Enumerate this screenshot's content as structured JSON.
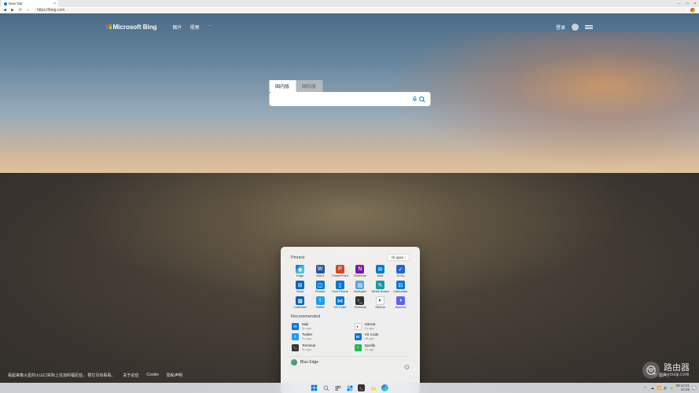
{
  "browser": {
    "tab_title": "New Tab",
    "url": "https://bing.com",
    "window_buttons": {
      "min": "–",
      "max": "□",
      "close": "×"
    }
  },
  "bing": {
    "logo_text": "Microsoft Bing",
    "nav": [
      "图片",
      "视频",
      "···"
    ],
    "login_text": "登录",
    "search_tabs": {
      "domestic": "国内版",
      "intl": "国际版"
    },
    "search_placeholder": "",
    "info_left": "看起来像火星的火山口实际上在加利福尼亚。 把它引向看看。",
    "info_links": [
      "关于必应",
      "Cookie",
      "隐私声明"
    ],
    "camera_badge": "图片",
    "prev": "‹",
    "next": "›"
  },
  "start": {
    "pinned_label": "Pinned",
    "all_apps_label": "All apps ›",
    "apps": [
      {
        "name": "Edge",
        "icon": "◉",
        "cls": "c-edge"
      },
      {
        "name": "Word",
        "icon": "W",
        "cls": "c-word"
      },
      {
        "name": "PowerPoint",
        "icon": "P",
        "cls": "c-ppt"
      },
      {
        "name": "OneNote",
        "icon": "N",
        "cls": "c-onenote"
      },
      {
        "name": "Mail",
        "icon": "✉",
        "cls": "c-mail"
      },
      {
        "name": "To Do",
        "icon": "✓",
        "cls": "c-todo"
      },
      {
        "name": "Store",
        "icon": "⊞",
        "cls": "c-store"
      },
      {
        "name": "Photos",
        "icon": "◫",
        "cls": "c-photos"
      },
      {
        "name": "Your Phone",
        "icon": "▯",
        "cls": "c-phone"
      },
      {
        "name": "Notepad",
        "icon": "▤",
        "cls": "c-notepad"
      },
      {
        "name": "White Board",
        "icon": "✎",
        "cls": "c-wb"
      },
      {
        "name": "Calculator",
        "icon": "⊟",
        "cls": "c-calc"
      },
      {
        "name": "Calendar",
        "icon": "▦",
        "cls": "c-cal"
      },
      {
        "name": "Twitter",
        "icon": "t",
        "cls": "c-twitter"
      },
      {
        "name": "VS Code",
        "icon": "⋈",
        "cls": "c-vscode"
      },
      {
        "name": "Terminal",
        "icon": "›_",
        "cls": "c-term"
      },
      {
        "name": "GitHub",
        "icon": "◐",
        "cls": "c-github"
      },
      {
        "name": "Discord",
        "icon": "◑",
        "cls": "c-discord"
      }
    ],
    "recommended_label": "Recommended",
    "recommended": [
      {
        "name": "Mail",
        "sub": "3h ago",
        "icon": "✉",
        "cls": "c-mail"
      },
      {
        "name": "GitHub",
        "sub": "2h ago",
        "icon": "◐",
        "cls": "c-github"
      },
      {
        "name": "Twitter",
        "sub": "2h ago",
        "icon": "t",
        "cls": "c-twitter"
      },
      {
        "name": "VS Code",
        "sub": "46 ago",
        "icon": "⋈",
        "cls": "c-vscode"
      },
      {
        "name": "Terminal",
        "sub": "5h ago",
        "icon": "›_",
        "cls": "c-term"
      },
      {
        "name": "Spotify",
        "sub": "1h ago",
        "icon": "♪",
        "cls": "c-spotify"
      }
    ],
    "user_name": "Blue Edge"
  },
  "taskbar": {
    "time": "08:14:21",
    "date": "10:45"
  },
  "watermark": {
    "line1": "路由器",
    "line2": "luyouqi.com"
  }
}
